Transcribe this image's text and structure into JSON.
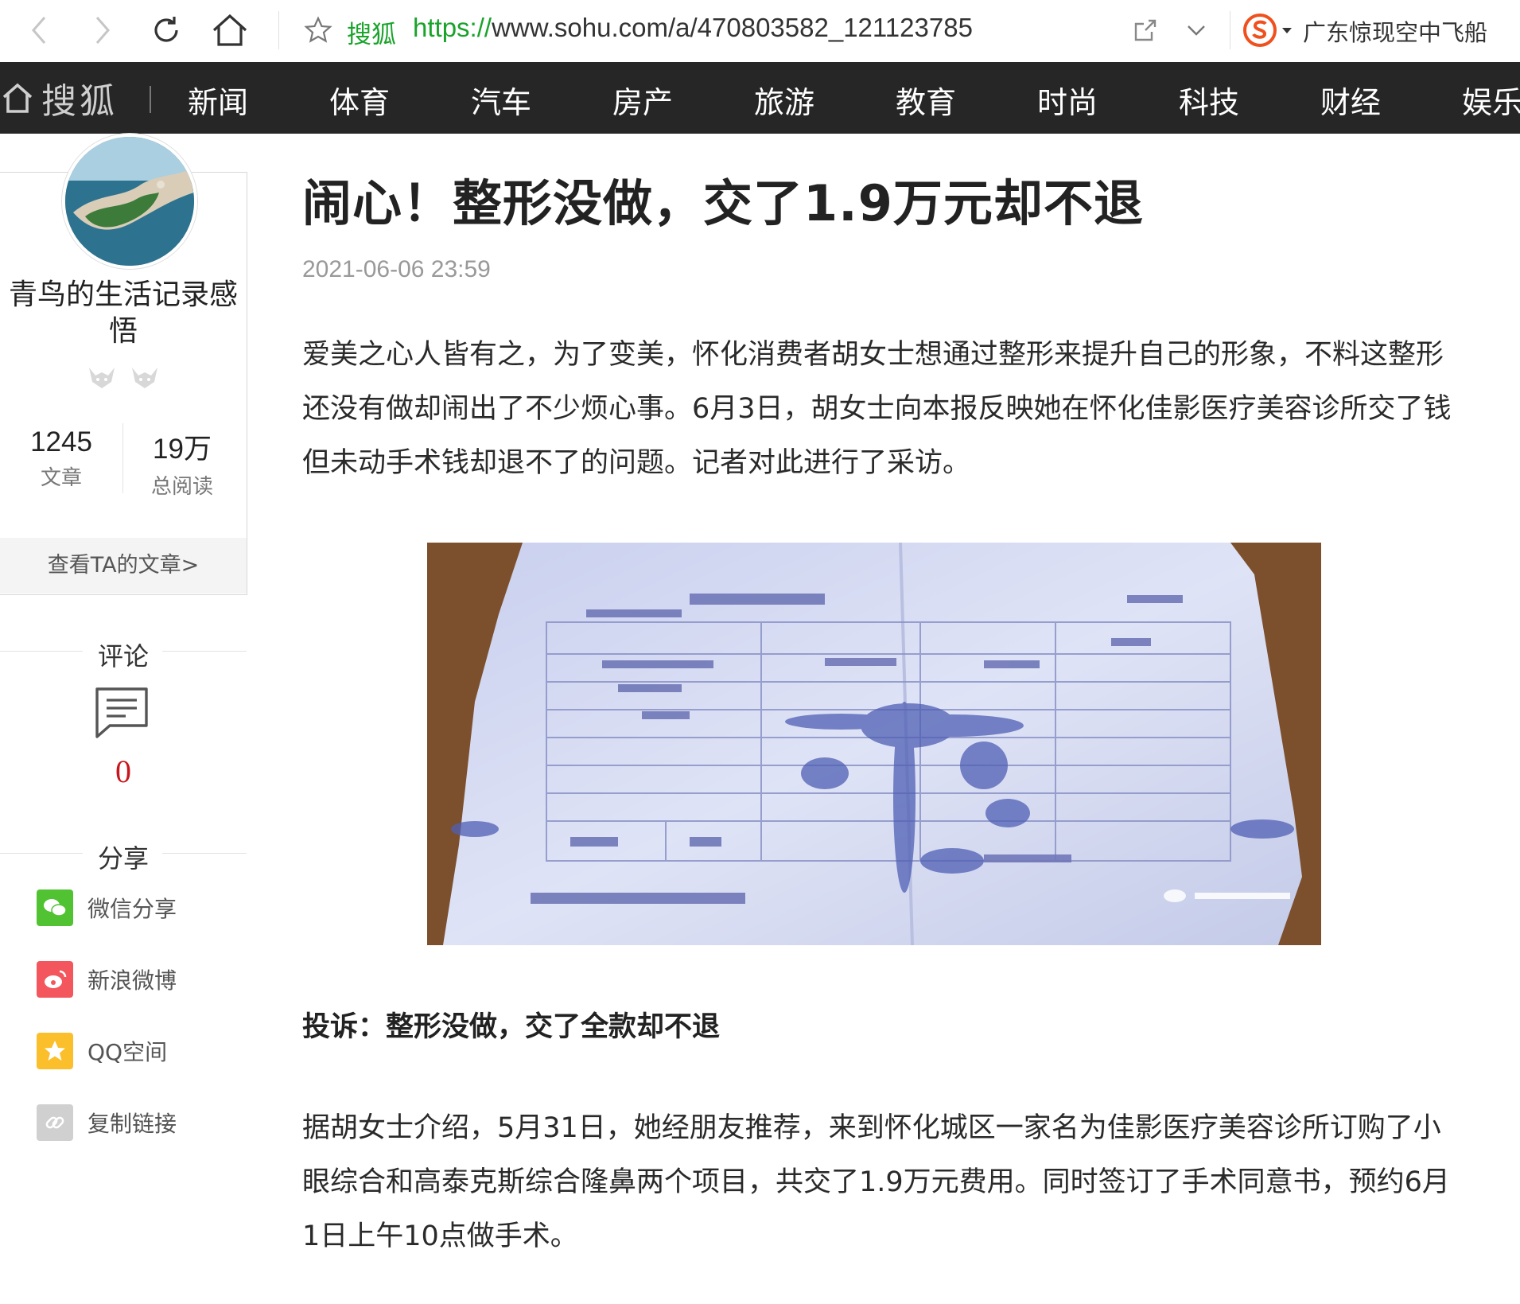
{
  "browser": {
    "address_site": "搜狐",
    "url_protocol": "https://",
    "url_rest": "www.sohu.com/a/470803582_121123785",
    "search_text": "广东惊现空中飞船"
  },
  "nav": {
    "logo_text": "搜狐",
    "items": [
      "新闻",
      "体育",
      "汽车",
      "房产",
      "旅游",
      "教育",
      "时尚",
      "科技",
      "财经",
      "娱乐"
    ]
  },
  "author": {
    "name": "青鸟的生活记录感悟",
    "articles_count": "1245",
    "articles_label": "文章",
    "reads_count": "19万",
    "reads_label": "总阅读",
    "view_articles": "查看TA的文章>"
  },
  "sidebar": {
    "comment_title": "评论",
    "comment_count": "0",
    "share_title": "分享",
    "share_items": [
      "微信分享",
      "新浪微博",
      "QQ空间",
      "复制链接"
    ]
  },
  "article": {
    "title": "闹心！整形没做，交了1.9万元却不退",
    "date": "2021-06-06 23:59",
    "para1": "爱美之心人皆有之，为了变美，怀化消费者胡女士想通过整形来提升自己的形象，不料这整形还没有做却闹出了不少烦心事。6月3日，胡女士向本报反映她在怀化佳影医疗美容诊所交了钱但未动手术钱却退不了的问题。记者对此进行了采访。",
    "subhead": "投诉：整形没做，交了全款却不退",
    "para2": "据胡女士介绍，5月31日，她经朋友推荐，来到怀化城区一家名为佳影医疗美容诊所订购了小眼综合和高泰克斯综合隆鼻两个项目，共交了1.9万元费用。同时签订了手术同意书，预约6月1日上午10点做手术。"
  },
  "colors": {
    "nav_bg": "#262626",
    "address_green": "#19a32a",
    "comment_red": "#c8161d",
    "wechat": "#51c332",
    "weibo": "#f3565d",
    "qzone": "#fbbf2b",
    "link": "#d0d0d0"
  }
}
